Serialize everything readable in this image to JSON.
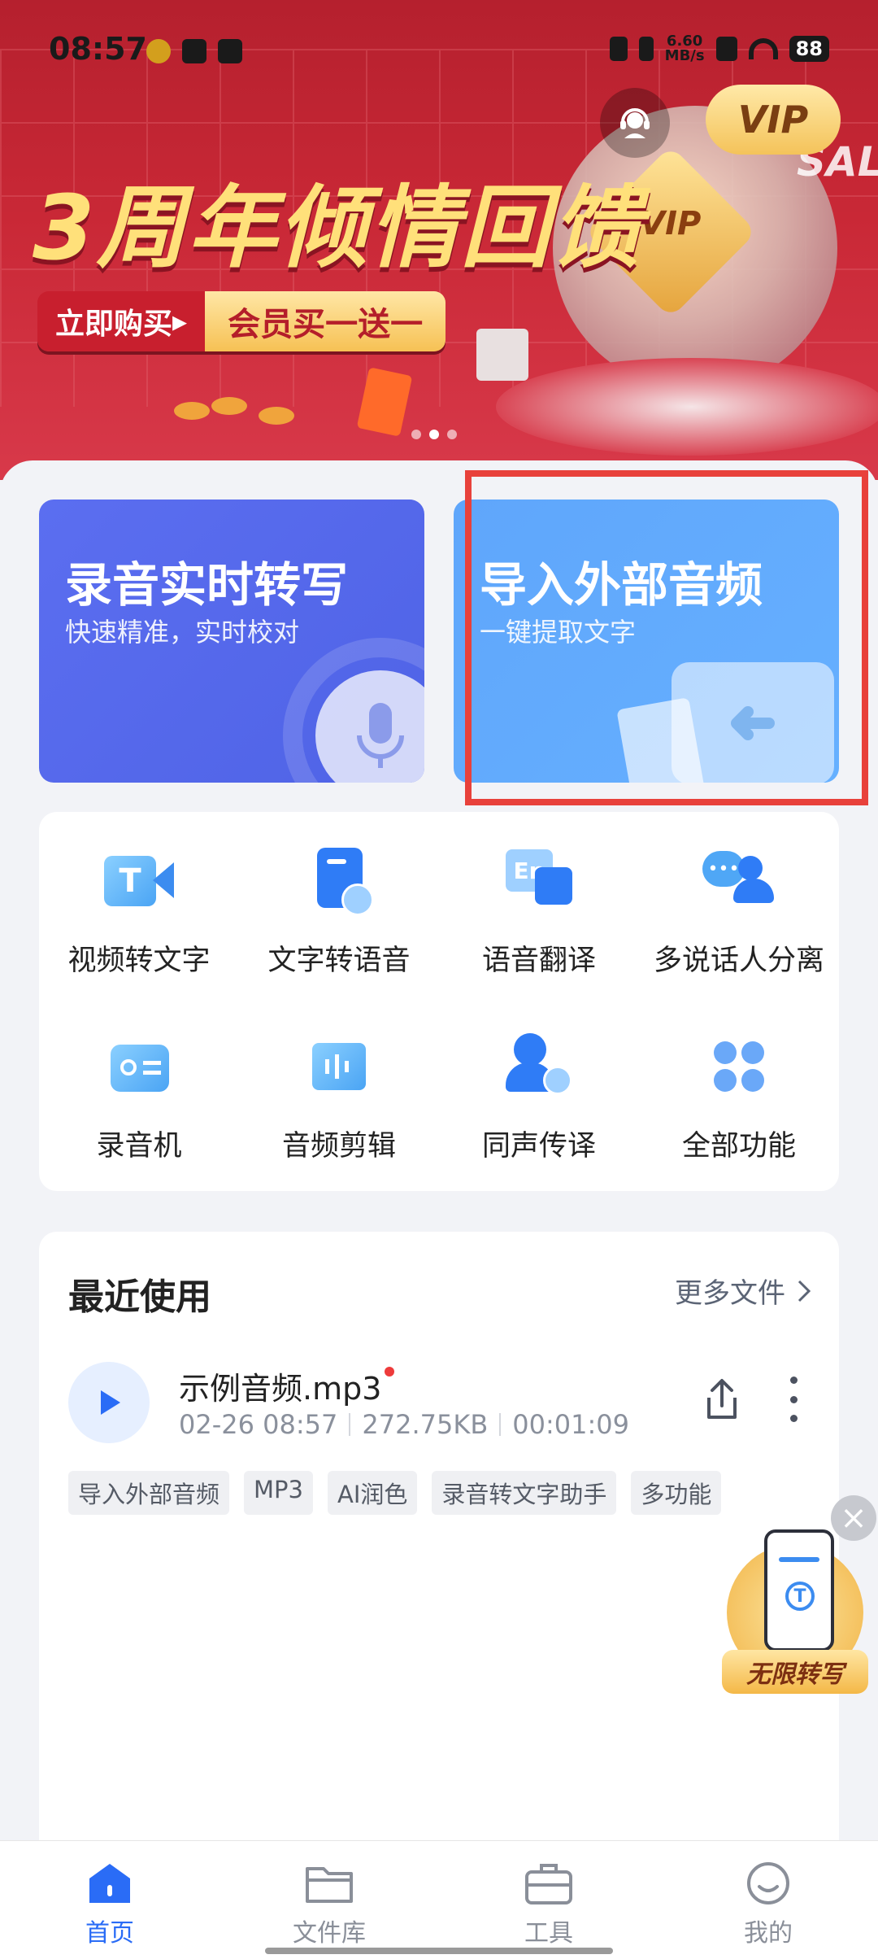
{
  "status_bar": {
    "time": "08:57",
    "net_speed_value": "6.60",
    "net_speed_unit": "MB/s",
    "battery": "88"
  },
  "banner": {
    "title": "3周年倾情回馈",
    "buy_now": "立即购买",
    "promo": "会员买一送一",
    "vip_button": "VIP",
    "badge_text": "VIP",
    "sale_text": "SAL",
    "page_count": 3,
    "active_page": 2
  },
  "cards": {
    "record": {
      "title": "录音实时转写",
      "subtitle": "快速精准，实时校对"
    },
    "import": {
      "title": "导入外部音频",
      "subtitle": "一键提取文字"
    }
  },
  "features": [
    {
      "label": "视频转文字",
      "icon": "video-to-text-icon"
    },
    {
      "label": "文字转语音",
      "icon": "text-to-speech-icon"
    },
    {
      "label": "语音翻译",
      "icon": "voice-translate-icon"
    },
    {
      "label": "多说话人分离",
      "icon": "multi-speaker-icon"
    },
    {
      "label": "录音机",
      "icon": "recorder-icon"
    },
    {
      "label": "音频剪辑",
      "icon": "audio-edit-icon"
    },
    {
      "label": "同声传译",
      "icon": "simultaneous-interpretation-icon"
    },
    {
      "label": "全部功能",
      "icon": "all-features-icon"
    }
  ],
  "recent": {
    "title": "最近使用",
    "more": "更多文件",
    "file": {
      "name": "示例音频.mp3",
      "date": "02-26 08:57",
      "size": "272.75KB",
      "duration": "00:01:09",
      "tags": [
        "导入外部音频",
        "MP3",
        "AI润色",
        "录音转文字助手",
        "多功能"
      ]
    }
  },
  "promo": {
    "label": "无限转写"
  },
  "nav": [
    {
      "label": "首页",
      "icon": "home-icon",
      "active": true
    },
    {
      "label": "文件库",
      "icon": "folder-icon",
      "active": false
    },
    {
      "label": "工具",
      "icon": "toolbox-icon",
      "active": false
    },
    {
      "label": "我的",
      "icon": "profile-icon",
      "active": false
    }
  ],
  "colors": {
    "accent": "#2a6cf6",
    "banner_red": "#c92836",
    "highlight": "#e8413b"
  }
}
